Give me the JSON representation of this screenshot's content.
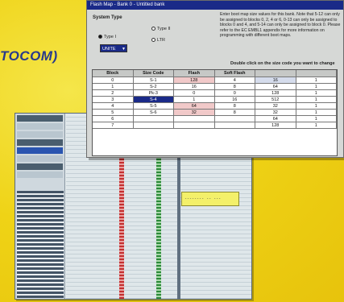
{
  "magazine": {
    "title_fragment": "TOCOM)"
  },
  "dialog": {
    "title": "Flash Map - Bank 0 - Untitled bank",
    "system_type_label": "System Type",
    "radio_type1": "Type I",
    "radio_type2": "Type II",
    "radio_type3": "LTR",
    "select_value": "UNITE",
    "note": "Enter boot map size values for this bank. Note that 5-12 can only be assigned to blocks 0, 2, 4 or 6, 0-13 can only be assigned to blocks 0 and 4, and 5-14 can only be assigned to block 0. Please refer to the EC EMBL1 appendix for more information on programming with different boot maps.",
    "dblclick_hint": "Double click on the size code you want to change",
    "columns": [
      "Block",
      "Size Code",
      "Flash",
      "Soft Flash",
      "",
      ""
    ],
    "rows": [
      [
        "0",
        "S-1",
        "128",
        "4",
        "16",
        "1"
      ],
      [
        "1",
        "S-2",
        "16",
        "8",
        "64",
        "1"
      ],
      [
        "2",
        "Pk-3",
        "0",
        "0",
        "128",
        "1"
      ],
      [
        "3",
        "S-4",
        "1",
        "16",
        "512",
        "1"
      ],
      [
        "4",
        "S-5",
        "64",
        "8",
        "32",
        "1"
      ],
      [
        "5",
        "S-6",
        "32",
        "8",
        "32",
        "1"
      ],
      [
        "6",
        "",
        "",
        "",
        "64",
        "1"
      ],
      [
        "7",
        "",
        "",
        "",
        "128",
        "1"
      ]
    ],
    "colors": {
      "titlebar": "#1a2a88",
      "selection": "#1a2a88"
    }
  },
  "back_window": {
    "popup_text": "-------- -- ---"
  }
}
